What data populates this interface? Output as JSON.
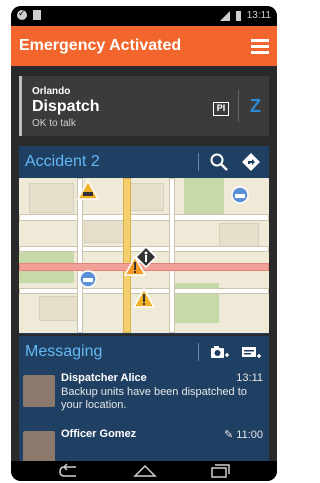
{
  "statusbar": {
    "time": "13:11"
  },
  "appbar": {
    "title": "Emergency Activated"
  },
  "dispatch": {
    "location": "Orlando",
    "name": "Dispatch",
    "status": "OK to talk",
    "badge": "PI",
    "brand_glyph": "Z"
  },
  "accident": {
    "title": "Accident 2"
  },
  "messaging": {
    "title": "Messaging",
    "messages": [
      {
        "sender": "Dispatcher Alice",
        "time": "13:11",
        "text": "Backup units have been dispatched to your location."
      },
      {
        "sender": "Officer Gomez",
        "time": "11:00",
        "text": ""
      }
    ]
  },
  "colors": {
    "accent": "#f2652c",
    "card": "#1f3f63",
    "link": "#64b9f5"
  }
}
